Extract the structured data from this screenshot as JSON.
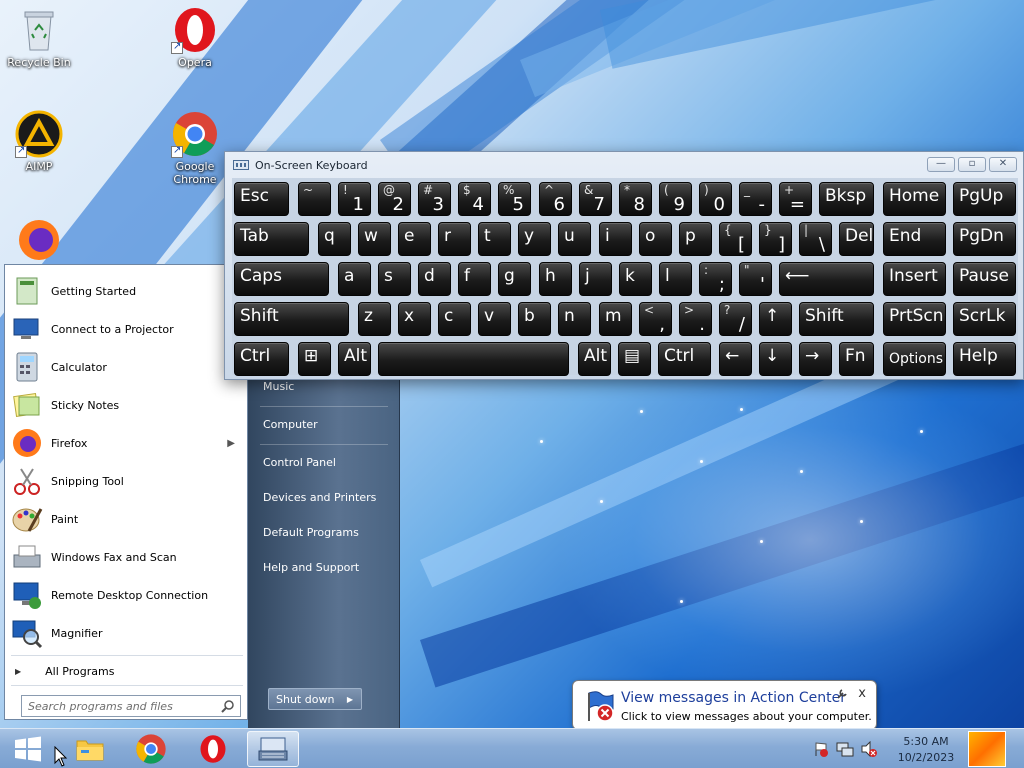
{
  "desktop": {
    "icons": [
      {
        "label": "Recycle Bin",
        "icon": "recycle-bin-icon"
      },
      {
        "label": "Opera",
        "icon": "opera-icon"
      },
      {
        "label": "AIMP",
        "icon": "aimp-icon"
      },
      {
        "label": "Google Chrome",
        "icon": "chrome-icon"
      },
      {
        "label": "",
        "icon": "firefox-icon"
      }
    ]
  },
  "osk": {
    "title": "On-Screen Keyboard",
    "controls": {
      "minimize": "▭",
      "restore": "▭",
      "close": "✕"
    },
    "keys": {
      "esc": "Esc",
      "tilde_top": "~",
      "tilde_bot": "`",
      "k1_top": "!",
      "k1": "1",
      "k2_top": "@",
      "k2": "2",
      "k3_top": "#",
      "k3": "3",
      "k4_top": "$",
      "k4": "4",
      "k5_top": "%",
      "k5": "5",
      "k6_top": "^",
      "k6": "6",
      "k7_top": "&",
      "k7": "7",
      "k8_top": "*",
      "k8": "8",
      "k9_top": "(",
      "k9": "9",
      "k0_top": ")",
      "k0": "0",
      "minus_top": "_",
      "minus": "-",
      "eq_top": "+",
      "eq": "=",
      "bksp": "Bksp",
      "home": "Home",
      "pgup": "PgUp",
      "tab": "Tab",
      "q": "q",
      "w": "w",
      "e": "e",
      "r": "r",
      "t": "t",
      "y": "y",
      "u": "u",
      "i": "i",
      "o": "o",
      "p": "p",
      "lbr_top": "{",
      "lbr": "[",
      "rbr_top": "}",
      "rbr": "]",
      "bsl_top": "|",
      "bsl": "\\",
      "del": "Del",
      "end": "End",
      "pgdn": "PgDn",
      "caps": "Caps",
      "a": "a",
      "s": "s",
      "d": "d",
      "f": "f",
      "g": "g",
      "h": "h",
      "j": "j",
      "k": "k",
      "l": "l",
      "semi_top": ":",
      "semi": ";",
      "quote_top": "\"",
      "quote": "'",
      "enter": "⟵",
      "insert": "Insert",
      "pause": "Pause",
      "shift": "Shift",
      "z": "z",
      "x": "x",
      "c": "c",
      "v": "v",
      "b": "b",
      "n": "n",
      "m": "m",
      "comma_top": "<",
      "comma": ",",
      "period_top": ">",
      "period": ".",
      "slash_top": "?",
      "slash": "/",
      "up": "↑",
      "shift_r": "Shift",
      "prtscn": "PrtScn",
      "scrlk": "ScrLk",
      "ctrl": "Ctrl",
      "win": "⊞",
      "alt": "Alt",
      "space": "",
      "alt_r": "Alt",
      "menu": "▤",
      "ctrl_r": "Ctrl",
      "left": "←",
      "down": "↓",
      "right": "→",
      "fn": "Fn",
      "options": "Options",
      "help": "Help"
    }
  },
  "start_menu": {
    "programs": [
      {
        "label": "Getting Started",
        "icon": "getting-started-icon",
        "submenu": false
      },
      {
        "label": "Connect to a Projector",
        "icon": "projector-icon",
        "submenu": false
      },
      {
        "label": "Calculator",
        "icon": "calculator-icon",
        "submenu": false
      },
      {
        "label": "Sticky Notes",
        "icon": "sticky-notes-icon",
        "submenu": false
      },
      {
        "label": "Firefox",
        "icon": "firefox-icon",
        "submenu": true
      },
      {
        "label": "Snipping Tool",
        "icon": "scissors-icon",
        "submenu": false
      },
      {
        "label": "Paint",
        "icon": "paint-icon",
        "submenu": false
      },
      {
        "label": "Windows Fax and Scan",
        "icon": "fax-icon",
        "submenu": false
      },
      {
        "label": "Remote Desktop Connection",
        "icon": "remote-desktop-icon",
        "submenu": false
      },
      {
        "label": "Magnifier",
        "icon": "magnifier-icon",
        "submenu": false
      }
    ],
    "all_programs": "All Programs",
    "search_placeholder": "Search programs and files",
    "right_links": [
      "Music",
      "Computer",
      "Control Panel",
      "Devices and Printers",
      "Default Programs",
      "Help and Support"
    ],
    "shutdown": "Shut down"
  },
  "notification": {
    "title": "View messages in Action Center",
    "text": "Click to view messages about your computer.",
    "close": "x"
  },
  "taskbar": {
    "items": [
      {
        "name": "start-button",
        "icon": "windows-logo-icon"
      },
      {
        "name": "file-explorer",
        "icon": "folder-icon"
      },
      {
        "name": "chrome",
        "icon": "chrome-icon"
      },
      {
        "name": "opera",
        "icon": "opera-icon"
      },
      {
        "name": "on-screen-keyboard",
        "icon": "keyboard-icon"
      }
    ],
    "clock": {
      "time": "5:30 AM",
      "date": "10/2/2023"
    }
  },
  "colors": {
    "taskbar": "#88abd6",
    "keycap": "#1b1b1b",
    "start_right_panel": "#5a7290",
    "link_blue": "#1e3f9c"
  }
}
